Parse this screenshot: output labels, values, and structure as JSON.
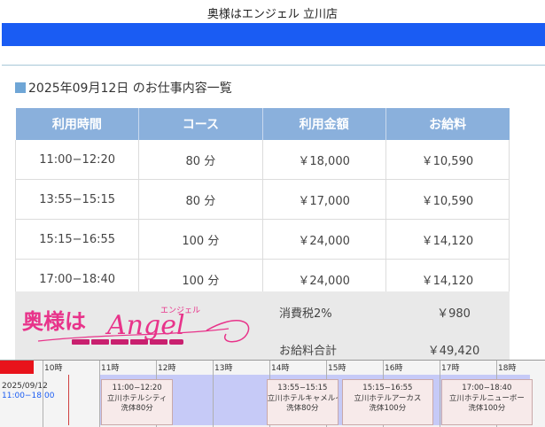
{
  "header": {
    "shop_title": "奥様はエンジェル 立川店",
    "bar_color": "#1a5cf3"
  },
  "page": {
    "heading": "2025年09月12日 のお仕事内容一覧"
  },
  "table": {
    "columns": [
      "利用時間",
      "コース",
      "利用金額",
      "お給料"
    ],
    "rows": [
      {
        "time": "11:00−12:20",
        "course": "80 分",
        "amount": "￥18,000",
        "pay": "￥10,590"
      },
      {
        "time": "13:55−15:15",
        "course": "80 分",
        "amount": "￥17,000",
        "pay": "￥10,590"
      },
      {
        "time": "15:15−16:55",
        "course": "100 分",
        "amount": "￥24,000",
        "pay": "￥14,120"
      },
      {
        "time": "17:00−18:40",
        "course": "100 分",
        "amount": "￥24,000",
        "pay": "￥14,120"
      }
    ],
    "header_color": "#8ab0dc"
  },
  "summary": {
    "tax_label": "消費税2%",
    "tax_value": "￥980",
    "total_label": "お給料合計",
    "total_value": "￥49,420"
  },
  "logo": {
    "text_main": "奥様は",
    "text_script": "Angel",
    "text_small": "エンジェル",
    "color": "#e8338a"
  },
  "timeline": {
    "hours": [
      "10時",
      "11時",
      "12時",
      "13時",
      "14時",
      "15時",
      "16時",
      "17時",
      "18時"
    ],
    "date": "2025/09/12",
    "date_time": "11:00−18:00",
    "bookings": [
      {
        "time": "11:00−12:20",
        "hotel": "立川ホテルシティ",
        "course": "洗体80分",
        "start_hour": 11.0,
        "end_hour": 12.333
      },
      {
        "time": "13:55−15:15",
        "hotel": "立川ホテルキャメルイ",
        "course": "洗体80分",
        "start_hour": 13.917,
        "end_hour": 15.25
      },
      {
        "time": "15:15−16:55",
        "hotel": "立川ホテルアーカス",
        "course": "洗体100分",
        "start_hour": 15.25,
        "end_hour": 16.917
      },
      {
        "time": "17:00−18:40",
        "hotel": "立川ホテルニューポー",
        "course": "洗体100分",
        "start_hour": 17.0,
        "end_hour": 18.667
      }
    ]
  }
}
